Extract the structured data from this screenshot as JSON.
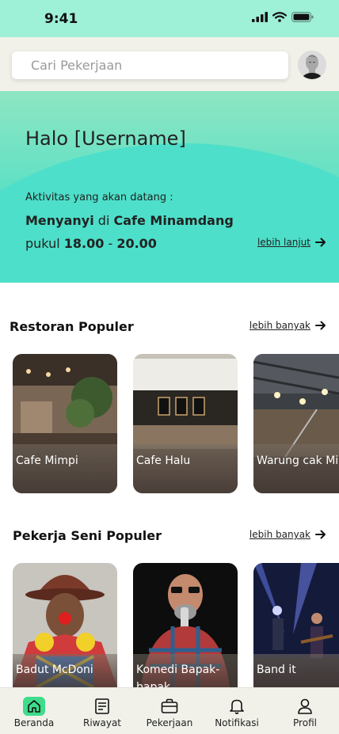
{
  "status": {
    "time": "9:41"
  },
  "search": {
    "placeholder": "Cari Pekerjaan"
  },
  "hero": {
    "greeting": "Halo [Username]",
    "activity_label": "Aktivitas yang akan datang :",
    "activity": "Menyanyi",
    "di": "di",
    "place": "Cafe Minamdang",
    "pukul": "pukul",
    "time_from": "18.00",
    "dash": "-",
    "time_to": "20.00",
    "more_label": "lebih lanjut"
  },
  "restaurants": {
    "title": "Restoran Populer",
    "more_label": "lebih banyak",
    "items": [
      {
        "name": "Cafe Mimpi"
      },
      {
        "name": "Cafe Halu"
      },
      {
        "name": "Warung cak Mi"
      }
    ]
  },
  "artists": {
    "title": "Pekerja Seni Populer",
    "more_label": "lebih banyak",
    "items": [
      {
        "name": "Badut McDoni"
      },
      {
        "name": "Komedi Bapak-bapak"
      },
      {
        "name": "Band it"
      }
    ]
  },
  "tabs": [
    {
      "label": "Beranda",
      "icon": "home-icon",
      "active": true
    },
    {
      "label": "Riwayat",
      "icon": "receipt-icon",
      "active": false
    },
    {
      "label": "Pekerjaan",
      "icon": "briefcase-icon",
      "active": false
    },
    {
      "label": "Notifikasi",
      "icon": "bell-icon",
      "active": false
    },
    {
      "label": "Profil",
      "icon": "user-icon",
      "active": false
    }
  ],
  "colors": {
    "accent": "#4ddfc9",
    "active_tab": "#3fdc8c",
    "status_bar": "#9ef0d6"
  }
}
